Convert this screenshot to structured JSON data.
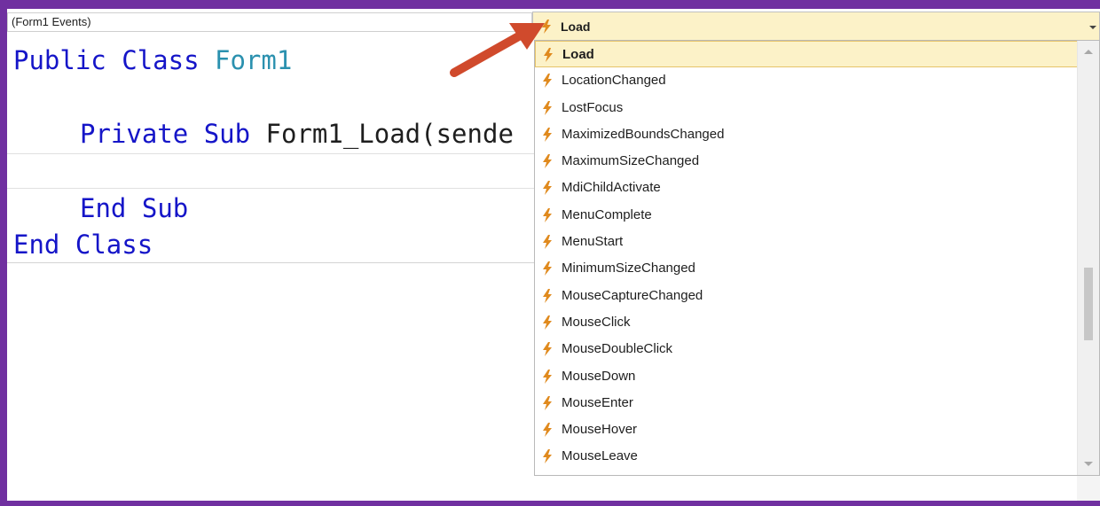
{
  "object_combo": {
    "value": "(Form1 Events)"
  },
  "event_combo": {
    "value": "Load",
    "icon": "lightning-bolt-icon"
  },
  "code": {
    "line1": {
      "kw1": "Public",
      "kw2": "Class",
      "name": "Form1"
    },
    "line2": {
      "kw1": "Private",
      "kw2": "Sub",
      "rest": "Form1_Load(sende"
    },
    "line3": {
      "kw1": "End",
      "kw2": "Sub"
    },
    "line4": {
      "kw1": "End",
      "kw2": "Class"
    }
  },
  "dropdown": {
    "selected": "Load",
    "items": [
      "Load",
      "LocationChanged",
      "LostFocus",
      "MaximizedBoundsChanged",
      "MaximumSizeChanged",
      "MdiChildActivate",
      "MenuComplete",
      "MenuStart",
      "MinimumSizeChanged",
      "MouseCaptureChanged",
      "MouseClick",
      "MouseDoubleClick",
      "MouseDown",
      "MouseEnter",
      "MouseHover",
      "MouseLeave"
    ]
  },
  "colors": {
    "frame": "#7030a0",
    "keyword": "#1515c8",
    "type": "#2b91af",
    "bolt": "#e08a1e",
    "arrow": "#d04a2c",
    "selection": "#fcf2c8"
  }
}
